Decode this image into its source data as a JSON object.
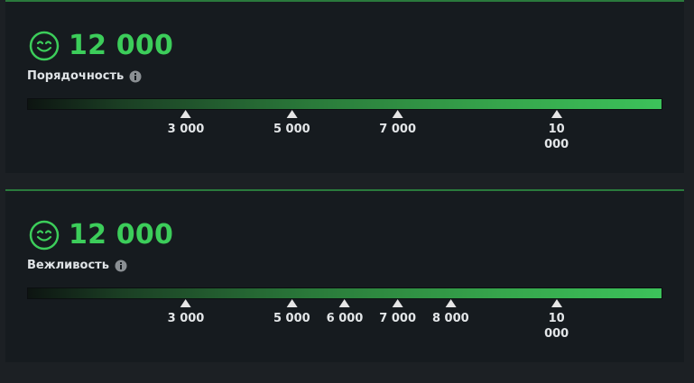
{
  "panels": [
    {
      "score": "12 000",
      "label": "Порядочность",
      "max": 12000,
      "markers": [
        {
          "value": 3000,
          "label": "3 000"
        },
        {
          "value": 5000,
          "label": "5 000"
        },
        {
          "value": 7000,
          "label": "7 000"
        },
        {
          "value": 10000,
          "label": "10 000"
        }
      ]
    },
    {
      "score": "12 000",
      "label": "Вежливость",
      "max": 12000,
      "markers": [
        {
          "value": 3000,
          "label": "3 000"
        },
        {
          "value": 5000,
          "label": "5 000"
        },
        {
          "value": 6000,
          "label": "6 000"
        },
        {
          "value": 7000,
          "label": "7 000"
        },
        {
          "value": 8000,
          "label": "8 000"
        },
        {
          "value": 10000,
          "label": "10 000"
        }
      ]
    }
  ],
  "icons": {
    "score": "smiley-face-icon",
    "info": "info-icon"
  },
  "colors": {
    "accent_green": "#3ccd5a",
    "panel_bg": "#161b1f",
    "page_bg": "#1c2024"
  }
}
